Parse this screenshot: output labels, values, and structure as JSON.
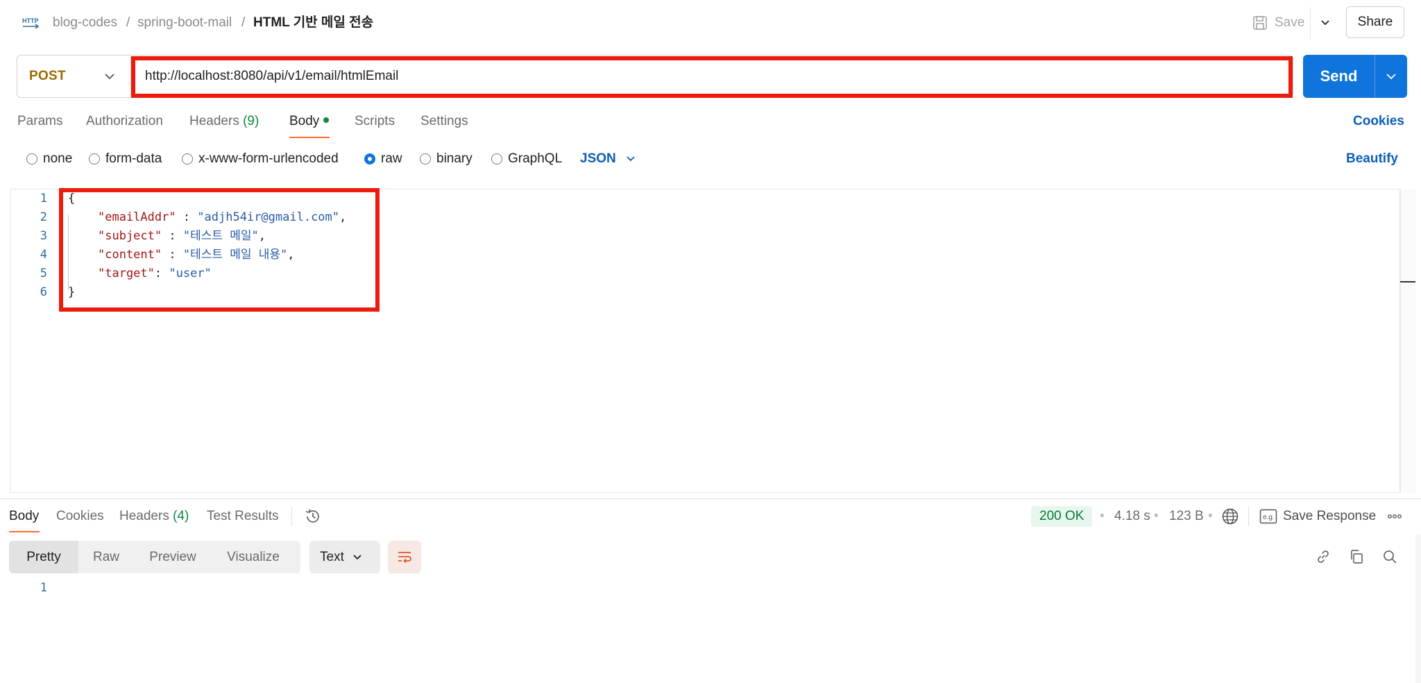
{
  "breadcrumb": {
    "workspace": "blog-codes",
    "collection": "spring-boot-mail",
    "separator": "/",
    "request_name": "HTML 기반 메일 전송"
  },
  "header": {
    "save_label": "Save",
    "share_label": "Share"
  },
  "request": {
    "method": "POST",
    "url": "http://localhost:8080/api/v1/email/htmlEmail",
    "send_label": "Send"
  },
  "request_tabs": {
    "params": "Params",
    "authorization": "Authorization",
    "headers": "Headers",
    "headers_count": "(9)",
    "body": "Body",
    "scripts": "Scripts",
    "settings": "Settings",
    "active": "Body",
    "cookies": "Cookies"
  },
  "body_types": {
    "none": "none",
    "form_data": "form-data",
    "urlencoded": "x-www-form-urlencoded",
    "raw": "raw",
    "binary": "binary",
    "graphql": "GraphQL",
    "selected": "raw",
    "language": "JSON",
    "beautify": "Beautify"
  },
  "editor": {
    "line_numbers": [
      "1",
      "2",
      "3",
      "4",
      "5",
      "6"
    ],
    "lines": {
      "l1_open": "{",
      "l2_key": "\"emailAddr\"",
      "l2_sep": " : ",
      "l2_val": "\"adjh54ir@gmail.com\"",
      "l2_end": ",",
      "l3_key": "\"subject\"",
      "l3_sep": " : ",
      "l3_val": "\"테스트 메일\"",
      "l3_end": ",",
      "l4_key": "\"content\"",
      "l4_sep": " : ",
      "l4_val": "\"테스트 메일 내용\"",
      "l4_end": ",",
      "l5_key": "\"target\"",
      "l5_sep": ": ",
      "l5_val": "\"user\"",
      "l6_close": "}"
    }
  },
  "response_tabs": {
    "body": "Body",
    "cookies": "Cookies",
    "headers": "Headers",
    "headers_count": "(4)",
    "test_results": "Test Results",
    "active": "Body"
  },
  "response_meta": {
    "status": "200 OK",
    "time": "4.18 s",
    "size": "123 B",
    "dot": "•",
    "save_response": "Save Response"
  },
  "response_view": {
    "pretty": "Pretty",
    "raw": "Raw",
    "preview": "Preview",
    "visualize": "Visualize",
    "active": "Pretty",
    "format": "Text",
    "line_numbers": [
      "1"
    ]
  },
  "colors": {
    "accent_blue": "#0f74db",
    "method_post": "#9c6a00",
    "highlight_red": "#ec1c0c",
    "tab_underline": "#ff6c37",
    "status_ok": "#0b7a36"
  },
  "icons": {
    "http": "http-icon",
    "save": "save-icon",
    "dropdown": "chevron-down-icon",
    "history": "history-icon",
    "globe": "globe-icon",
    "example": "eg-icon",
    "more": "more-horizontal-icon",
    "wrap": "word-wrap-icon",
    "link": "link-icon",
    "copy": "copy-icon",
    "search": "search-icon"
  }
}
